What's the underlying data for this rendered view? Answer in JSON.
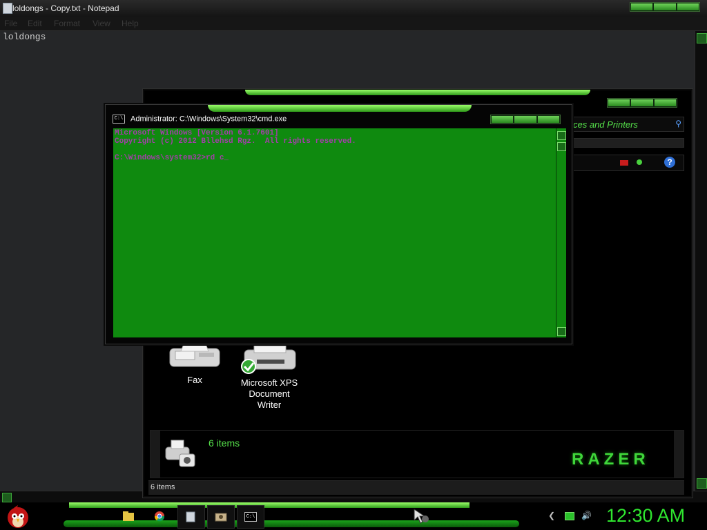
{
  "notepad": {
    "title": "loldongs - Copy.txt - Notepad",
    "menu": [
      "File",
      "Edit",
      "Format",
      "View",
      "Help"
    ],
    "content": "loldongs"
  },
  "devices_window": {
    "search_text": "ces and Printers",
    "devices": [
      {
        "label": "Fax",
        "icon": "fax-icon"
      },
      {
        "label": "Microsoft XPS\nDocument\nWriter",
        "icon": "printer-default-icon"
      }
    ],
    "details_count": "6 items",
    "brand": "RAZER",
    "status": "6 items"
  },
  "cmd": {
    "title": "Administrator: C:\\Windows\\System32\\cmd.exe",
    "icon_text": "C:\\",
    "lines": [
      "Microsoft Windows [Version 6.1.7601]",
      "Copyright (c) 2012 Bllehsd Rgz.  All rights reserved.",
      "",
      "C:\\Windows\\system32>rd c_"
    ]
  },
  "taskbar": {
    "clock": "12:30 AM",
    "pinned": [
      "explorer-icon",
      "chrome-icon",
      "notepad-icon",
      "media-icon",
      "cmd-icon"
    ],
    "cmd_icon_text": "C:\\",
    "colors": {
      "accent": "#2fe62f",
      "cmd_bg": "#0f8a0f",
      "cmd_text": "#a23fa8"
    }
  }
}
